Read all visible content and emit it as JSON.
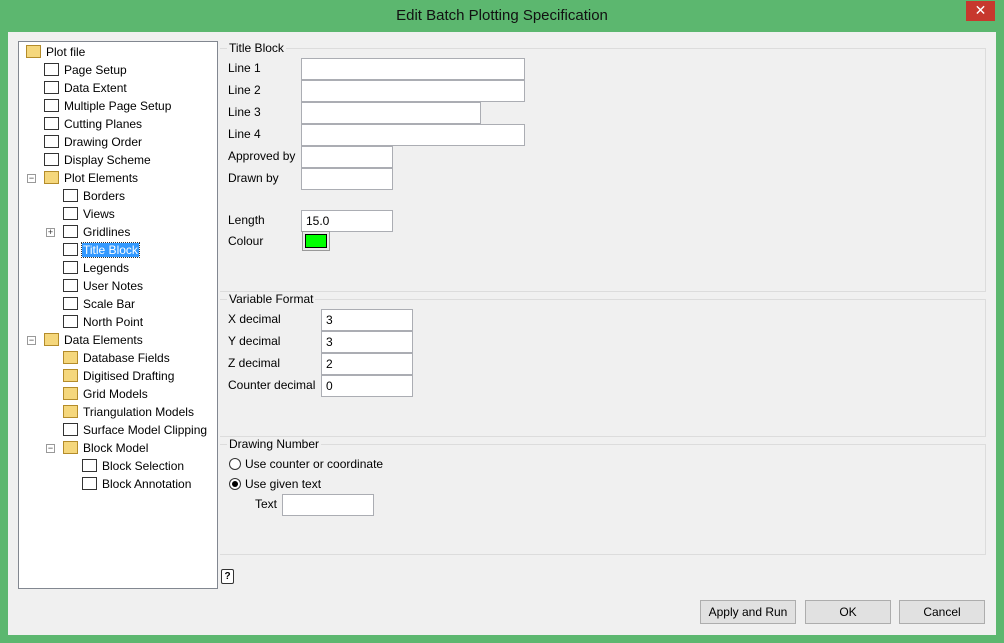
{
  "window": {
    "title": "Edit Batch Plotting Specification",
    "close": "✕"
  },
  "tree": [
    {
      "label": "Plot file",
      "level": 0,
      "folder": true
    },
    {
      "label": "Page Setup",
      "level": 1
    },
    {
      "label": "Data Extent",
      "level": 1
    },
    {
      "label": "Multiple Page Setup",
      "level": 1
    },
    {
      "label": "Cutting Planes",
      "level": 1
    },
    {
      "label": "Drawing Order",
      "level": 1
    },
    {
      "label": "Display Scheme",
      "level": 1
    },
    {
      "label": "Plot Elements",
      "level": 1,
      "folder": true,
      "expander": "−"
    },
    {
      "label": "Borders",
      "level": 2
    },
    {
      "label": "Views",
      "level": 2
    },
    {
      "label": "Gridlines",
      "level": 2,
      "expander": "+"
    },
    {
      "label": "Title Block",
      "level": 2,
      "selected": true
    },
    {
      "label": "Legends",
      "level": 2
    },
    {
      "label": "User Notes",
      "level": 2
    },
    {
      "label": "Scale Bar",
      "level": 2
    },
    {
      "label": "North Point",
      "level": 2
    },
    {
      "label": "Data Elements",
      "level": 1,
      "folder": true,
      "expander": "−"
    },
    {
      "label": "Database Fields",
      "level": 2,
      "folder": true
    },
    {
      "label": "Digitised Drafting",
      "level": 2,
      "folder": true
    },
    {
      "label": "Grid Models",
      "level": 2,
      "folder": true
    },
    {
      "label": "Triangulation Models",
      "level": 2,
      "folder": true
    },
    {
      "label": "Surface Model Clipping",
      "level": 2
    },
    {
      "label": "Block Model",
      "level": 2,
      "folder": true,
      "expander": "−"
    },
    {
      "label": "Block Selection",
      "level": 3
    },
    {
      "label": "Block Annotation",
      "level": 3
    }
  ],
  "title_block": {
    "title": "Title Block",
    "line1": "Line 1",
    "line2": "Line 2",
    "line3": "Line 3",
    "line4": "Line 4",
    "approved_by": "Approved by",
    "drawn_by": "Drawn by",
    "length_label": "Length",
    "length_value": "15.0",
    "colour_label": "Colour",
    "colour": "#00ff00"
  },
  "variable_format": {
    "title": "Variable Format",
    "x_label": "X decimal",
    "x": "3",
    "y_label": "Y decimal",
    "y": "3",
    "z_label": "Z decimal",
    "z": "2",
    "c_label": "Counter decimal",
    "c": "0"
  },
  "drawing_number": {
    "title": "Drawing Number",
    "opt1": "Use counter or coordinate",
    "opt2": "Use given text",
    "text_label": "Text",
    "text_value": ""
  },
  "buttons": {
    "help": "?",
    "apply": "Apply and Run",
    "ok": "OK",
    "cancel": "Cancel"
  }
}
